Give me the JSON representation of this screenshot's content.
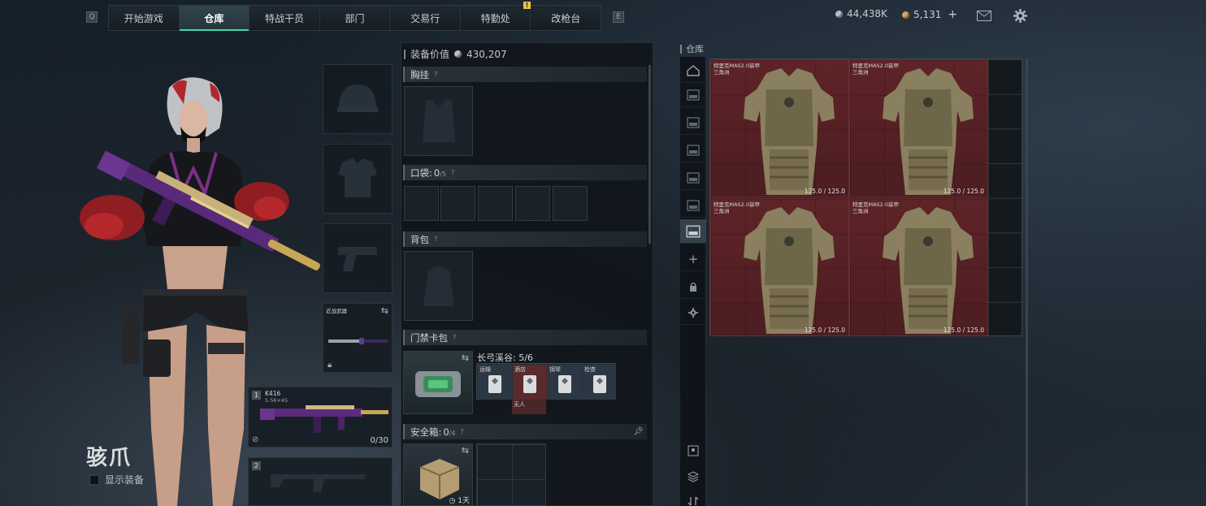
{
  "nav": {
    "left_key": "Q",
    "right_key": "E",
    "notification": "!",
    "tabs": [
      {
        "label": "开始游戏",
        "active": false
      },
      {
        "label": "仓库",
        "active": true
      },
      {
        "label": "特战干员",
        "active": false
      },
      {
        "label": "部门",
        "active": false
      },
      {
        "label": "交易行",
        "active": false
      },
      {
        "label": "特勤处",
        "active": false
      },
      {
        "label": "改枪台",
        "active": false
      }
    ]
  },
  "currency": {
    "silver": "44,438K",
    "gold": "5,131",
    "add": "+"
  },
  "operator": {
    "name": "骇爪",
    "show_gear_label": "显示装备"
  },
  "loadout": {
    "melee_label": "近战武器",
    "primary_index": "1",
    "primary_name": "K416",
    "primary_ammo": "5.56×45",
    "primary_count": "0/30",
    "secondary_index": "2"
  },
  "equipment": {
    "value_label": "装备价值",
    "value": "430,207",
    "chest_rig": "胸挂",
    "pockets_label": "口袋:",
    "pockets_count": "0",
    "pockets_capacity": "/5",
    "backpack": "背包",
    "keycard_label": "门禁卡包",
    "keycard_case": "长弓溪谷: 5/6",
    "keycards": [
      "运输",
      "酒店",
      "钢琴",
      "检查"
    ],
    "keycard_extra": "无人",
    "safebox_label": "安全箱:",
    "safebox_count": "0",
    "safebox_capacity": "/4",
    "safebox_timer": "1天",
    "help": "?"
  },
  "warehouse": {
    "title": "仓库",
    "items": [
      {
        "name": "特里克MAS2.0装甲",
        "sub": "三角洲",
        "durability": "125.0 / 125.0"
      },
      {
        "name": "特里克MAS2.0装甲",
        "sub": "三角洲",
        "durability": "125.0 / 125.0"
      },
      {
        "name": "特里克MAS2.0装甲",
        "sub": "三角洲",
        "durability": "125.0 / 125.0"
      },
      {
        "name": "特里克MAS2.0装甲",
        "sub": "三角洲",
        "durability": "125.0 / 125.0"
      }
    ],
    "sidebar_plus": "+",
    "item_color": "#5e2428"
  }
}
